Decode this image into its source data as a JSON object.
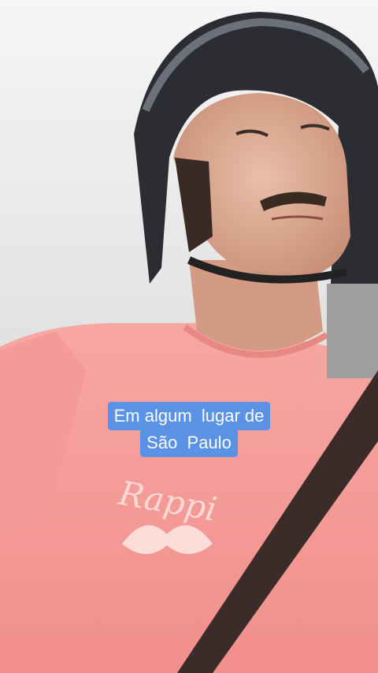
{
  "caption": {
    "lines": [
      "Em algum  lugar de",
      "São  Paulo"
    ]
  },
  "shirt_logo": "Rappi",
  "colors": {
    "caption_bg": "#5a93e6",
    "caption_text": "#ffffff",
    "shirt": "#f49b97",
    "helmet": "#2b2d33",
    "sky": "#e8e8e8"
  }
}
